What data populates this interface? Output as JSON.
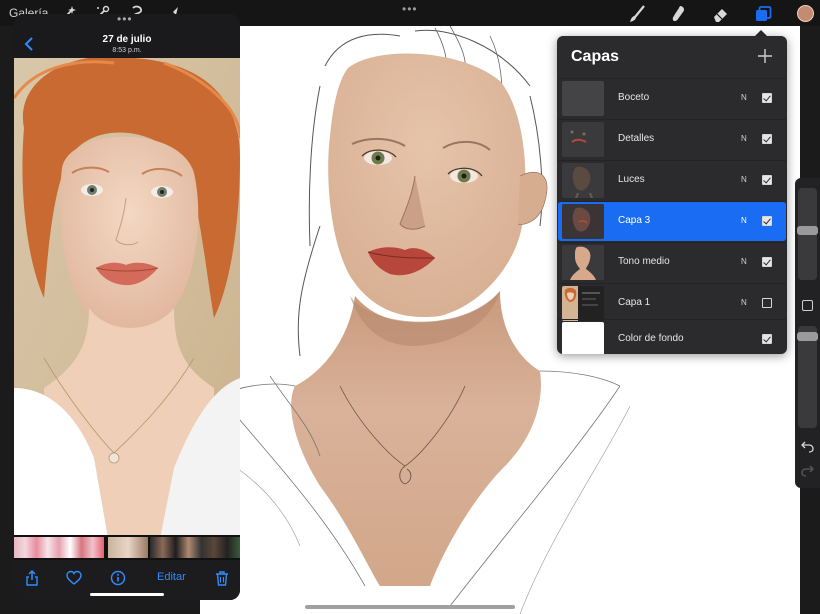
{
  "toolbar": {
    "gallery_label": "Galería",
    "left_tools": [
      "wand-icon",
      "adjustments-icon",
      "selection-icon",
      "transform-arrow-icon"
    ],
    "right_tools": [
      "brush-icon",
      "smudge-icon",
      "eraser-icon",
      "layers-icon"
    ],
    "active_tool": "layers-icon",
    "current_color": "#c58b70"
  },
  "photos": {
    "date": "27 de julio",
    "time": "8:53 p.m.",
    "edit_label": "Editar",
    "toolbar_icons": [
      "share-icon",
      "heart-icon",
      "info-icon",
      "trash-icon"
    ]
  },
  "layers": {
    "title": "Capas",
    "items": [
      {
        "name": "Boceto",
        "blend": "N",
        "visible": true,
        "active": false
      },
      {
        "name": "Detalles",
        "blend": "N",
        "visible": true,
        "active": false
      },
      {
        "name": "Luces",
        "blend": "N",
        "visible": true,
        "active": false
      },
      {
        "name": "Capa 3",
        "blend": "N",
        "visible": true,
        "active": true
      },
      {
        "name": "Tono medio",
        "blend": "N",
        "visible": true,
        "active": false
      },
      {
        "name": "Capa 1",
        "blend": "N",
        "visible": false,
        "active": false
      },
      {
        "name": "Color de fondo",
        "blend": "",
        "visible": true,
        "active": false
      }
    ]
  },
  "colors": {
    "accent": "#1a6cf2",
    "ios_blue": "#2f8cff"
  }
}
